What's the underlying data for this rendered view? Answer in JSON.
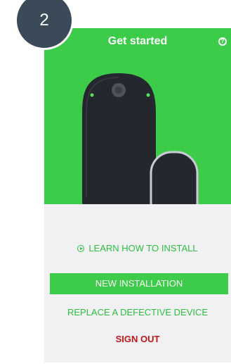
{
  "step_badge": "2",
  "header": {
    "title": "Get started",
    "help_icon": "help-circle-icon",
    "help_glyph": "?"
  },
  "hero": {
    "background_color": "#3dcc4a",
    "illustration": "hub-and-sensor-device"
  },
  "actions": {
    "learn_label": "LEARN HOW TO INSTALL",
    "learn_icon": "play-circle-icon",
    "new_installation_label": "NEW INSTALLATION",
    "replace_label": "REPLACE A DEFECTIVE DEVICE",
    "sign_out_label": "SIGN OUT"
  },
  "colors": {
    "accent_green": "#3dcc4a",
    "link_green": "#2fbf3f",
    "danger_red": "#c01818",
    "badge_bg": "#3a4a59"
  }
}
